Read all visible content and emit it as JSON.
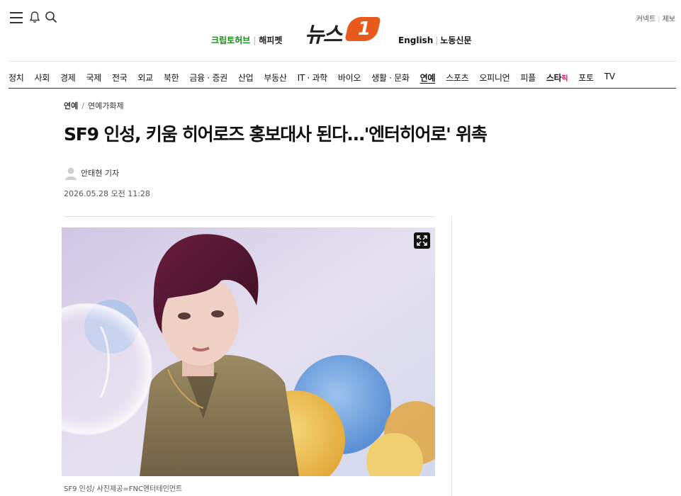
{
  "header": {
    "icons": [
      "menu-icon",
      "bell-icon",
      "search-icon"
    ],
    "partners": {
      "primary": "크립토허브",
      "secondary": "해피펫"
    },
    "logo_text": "뉴스",
    "logo_number": "1",
    "languages": {
      "english": "English",
      "labor": "노동신문"
    },
    "utility": {
      "connect": "커넥트",
      "report": "제보"
    }
  },
  "nav": {
    "items": [
      "정치",
      "사회",
      "경제",
      "국제",
      "전국",
      "외교",
      "북한",
      "금융 · 증권",
      "산업",
      "부동산",
      "IT · 과학",
      "바이오",
      "생활 · 문화",
      "연예",
      "스포츠",
      "오피니언",
      "피플",
      "스타",
      "포토",
      "TV"
    ],
    "star_pick": "픽",
    "active": "연예"
  },
  "article": {
    "breadcrumb": {
      "section": "연예",
      "subsection": "연예가화제"
    },
    "headline": "SF9 인성, 키움 히어로즈 홍보대사 된다…'엔터히어로' 위촉",
    "author": "안태현 기자",
    "date": "2026.05.28 오전 11:28",
    "caption": "SF9 인성/ 사진제공=FNC엔터테인먼트"
  },
  "colors": {
    "accent": "#e85a1b",
    "partner_green": "#1a8a1a",
    "star_pick": "#e0177b"
  }
}
